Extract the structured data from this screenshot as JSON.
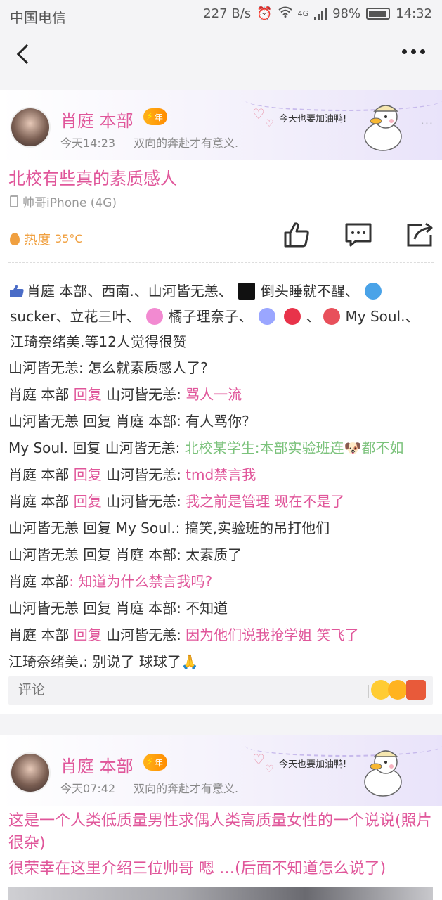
{
  "status_bar": {
    "carrier": "中国电信",
    "speed": "227 B/s",
    "network": "4G",
    "battery": "98%",
    "time": "14:32"
  },
  "decor": {
    "slogan": "今天也要加油鸭!",
    "more": "···"
  },
  "posts": [
    {
      "author": "肖庭 本部",
      "vip_label": "年",
      "time": "今天14:23",
      "signature": "双向的奔赴才有意义.",
      "title": "北校有些真的素质感人",
      "device": "帅哥iPhone (4G)",
      "heat_label": "热度",
      "heat_value": "35°C",
      "likes_text_1": "肖庭 本部、西南.、山河皆无恙、",
      "likes_text_2": "倒头睡就不醒、",
      "likes_text_3": "sucker、立花三叶、",
      "likes_text_4": "橘子理奈子、",
      "likes_text_5": "、",
      "likes_text_6": "、",
      "likes_text_7": "My Soul.、",
      "likes_text_8": "江琦奈绪美.等12人觉得很赞",
      "comments": [
        {
          "name": "山河皆无恙:",
          "text": " 怎么就素质感人了?"
        },
        {
          "name": "肖庭 本部",
          "reply": "回复",
          "target": "山河皆无恙:",
          "text": " 骂人一流"
        },
        {
          "name": "山河皆无恙 回复 肖庭 本部:",
          "text": " 有人骂你?"
        },
        {
          "name": "My Soul. 回复 山河皆无恙:",
          "text": " 北校某学生:本部实验班连🐶都不如"
        },
        {
          "name": "肖庭 本部",
          "reply": "回复",
          "target": "山河皆无恙:",
          "text": " tmd禁言我"
        },
        {
          "name": "肖庭 本部",
          "reply": "回复",
          "target": "山河皆无恙:",
          "text": " 我之前是管理 现在不是了"
        },
        {
          "name": "山河皆无恙 回复 My Soul.:",
          "text": " 搞笑,实验班的吊打他们"
        },
        {
          "name": "山河皆无恙 回复 肖庭 本部:",
          "text": " 太素质了"
        },
        {
          "name": "肖庭 本部",
          "text": ": 知道为什么禁言我吗?"
        },
        {
          "name": "山河皆无恙 回复 肖庭 本部:",
          "text": " 不知道"
        },
        {
          "name": "肖庭 本部",
          "reply": "回复",
          "target": "山河皆无恙:",
          "text": " 因为他们说我抢学姐 笑飞了"
        },
        {
          "name": "江琦奈绪美.:",
          "text": " 别说了 球球了🙏"
        }
      ],
      "comment_placeholder": "评论"
    },
    {
      "author": "肖庭 本部",
      "vip_label": "年",
      "time": "今天07:42",
      "signature": "双向的奔赴才有意义.",
      "text_1": "这是一个人类低质量男性求偶人类高质量女性的一个说说(照片很杂)",
      "text_2": "很荣幸在这里介绍三位帅哥 嗯 …(后面不知道怎么说了)"
    }
  ]
}
